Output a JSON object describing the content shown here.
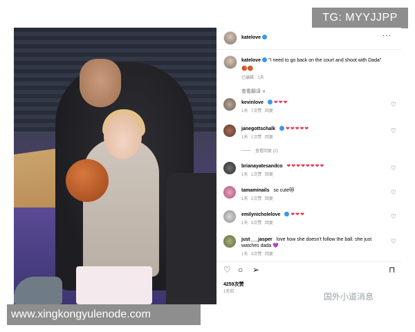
{
  "watermarks": {
    "top": "TG: MYYJJPP",
    "bottom": "www.xingkongyulenode.com",
    "source": "国外小道消息"
  },
  "post": {
    "username": "katelove",
    "more_icon": "···",
    "caption": {
      "username": "katelove",
      "text": "\"I need to go back on the court and shoot with Dada\"",
      "emoji": "🏀🏀",
      "meta": "已编辑 · 1天"
    },
    "translate_label": "查看翻译 ∨",
    "comments": [
      {
        "username": "kevinlove",
        "verified": true,
        "text": "❤❤❤",
        "meta": "1天 7次赞 回复"
      },
      {
        "username": "janegottschalk",
        "verified": true,
        "text": "❤❤❤❤❤",
        "meta": "1天 1次赞 回复"
      },
      {
        "username": "brianayatesandco",
        "verified": false,
        "text": "❤❤❤❤❤❤❤❤",
        "meta": "1天 1次赞 回复"
      },
      {
        "username": "tamaminails",
        "verified": false,
        "text": "so cute😻",
        "meta": "1天 2次赞 回复"
      },
      {
        "username": "emilynicholelove",
        "verified": true,
        "text": "❤❤❤",
        "meta": "1天 5次赞 回复"
      },
      {
        "username": "just___jasper",
        "verified": false,
        "text": "love how she doesn't follow the ball. she just watches dada 💜",
        "meta": "1天 3次赞 回复"
      }
    ],
    "view_replies": "查看回复 (2)",
    "likes": "4259次赞",
    "date": "1天前"
  },
  "colors": {
    "verified": "#3897f0",
    "heart": "#e8334a",
    "watermark_bg": "#8e8e8e"
  }
}
